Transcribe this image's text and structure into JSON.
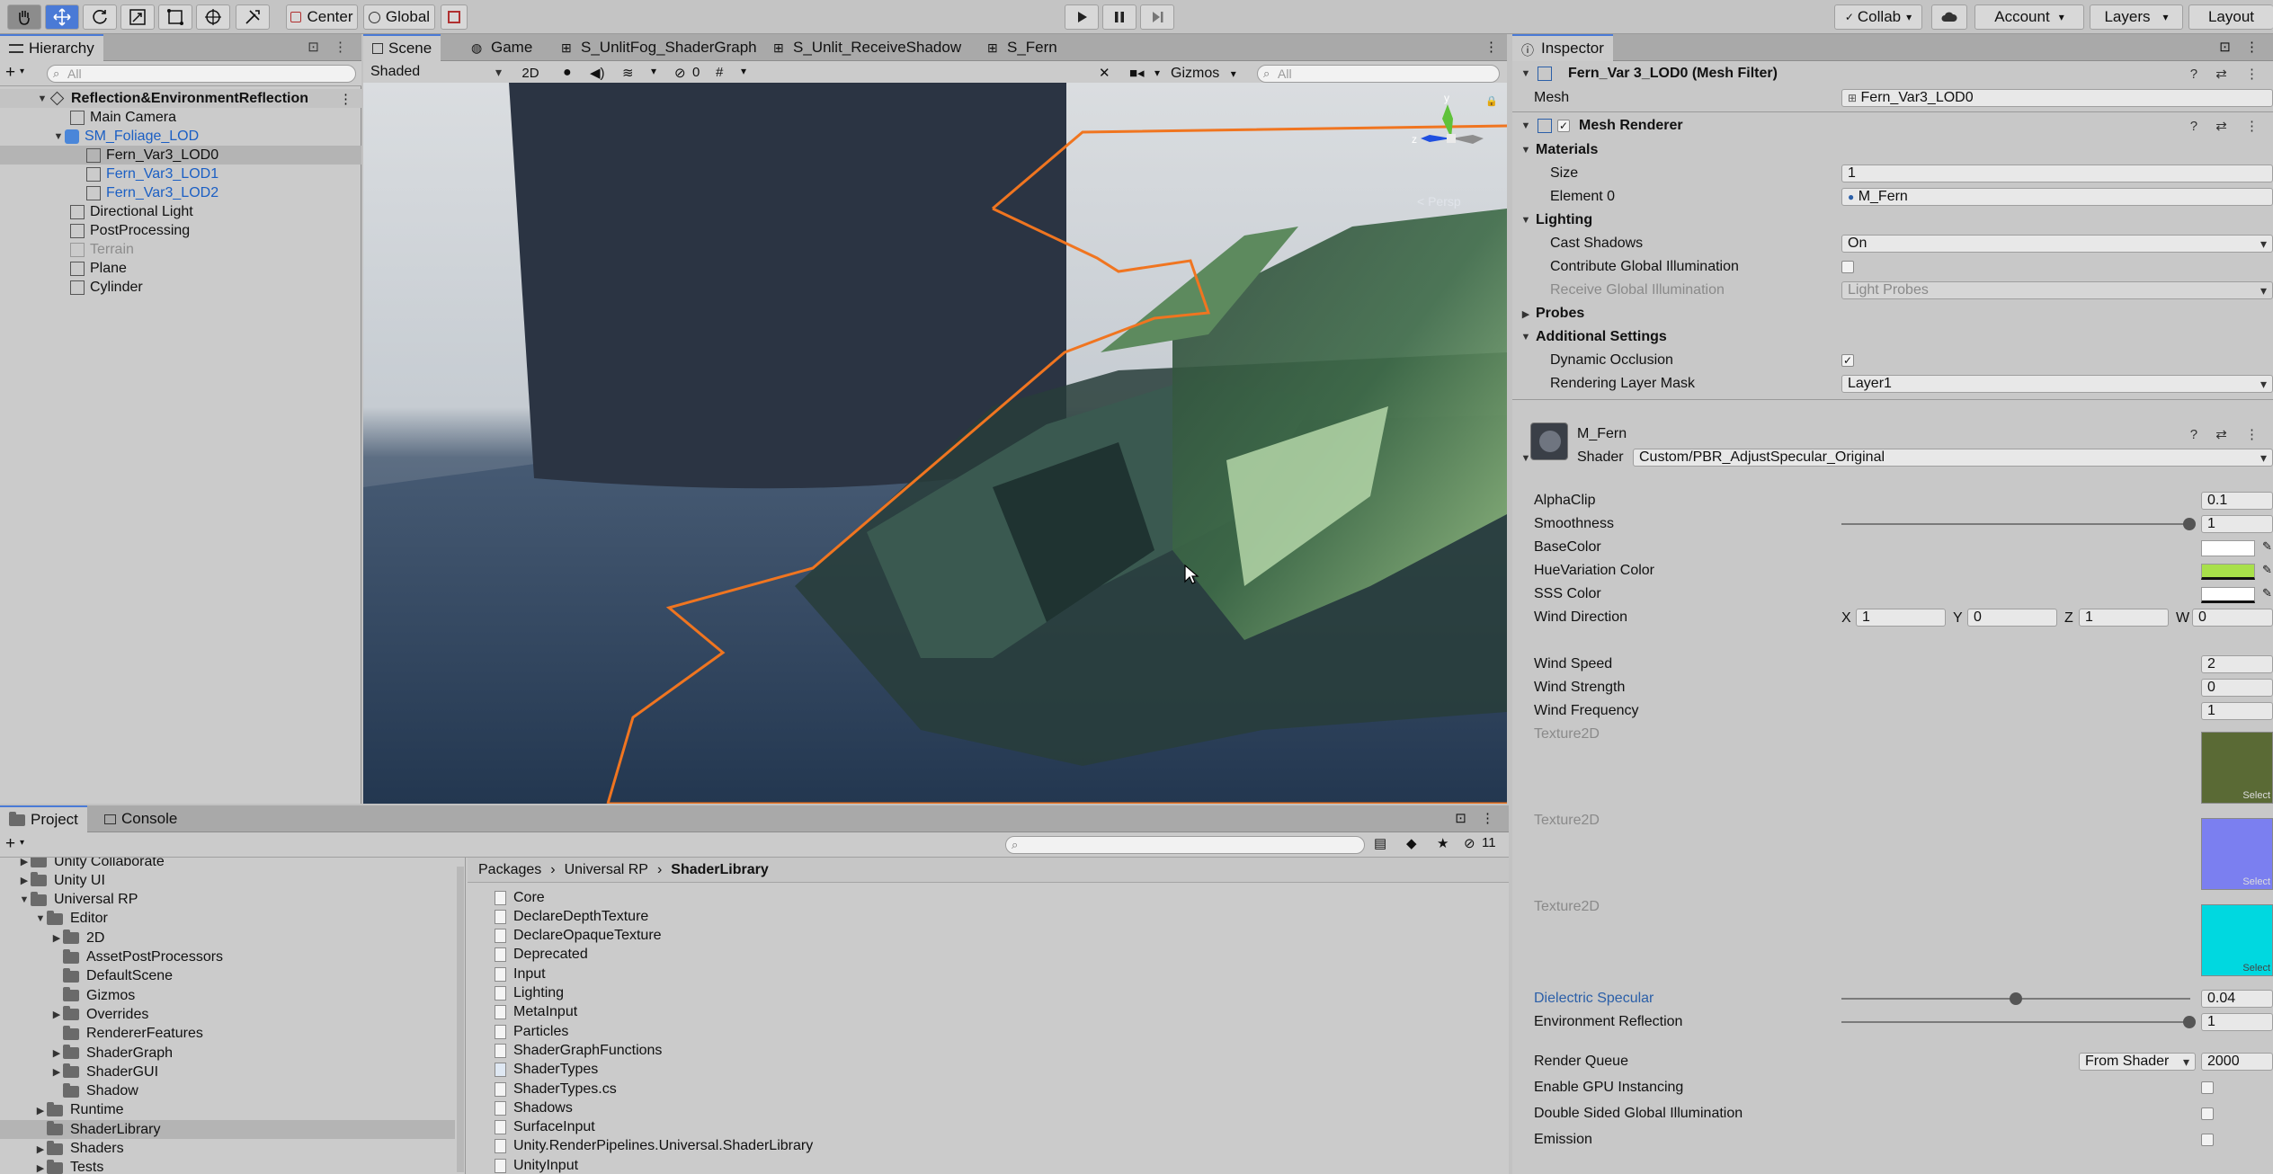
{
  "toolbar": {
    "pivot": "Center",
    "space": "Global",
    "collab": "Collab",
    "account": "Account",
    "layers": "Layers",
    "layout": "Layout"
  },
  "hierarchy": {
    "tab": "Hierarchy",
    "search_placeholder": "All",
    "scene_name": "Reflection&EnvironmentReflection",
    "items": [
      {
        "label": "Main Camera"
      },
      {
        "label": "SM_Foliage_LOD"
      },
      {
        "label": "Fern_Var3_LOD0"
      },
      {
        "label": "Fern_Var3_LOD1"
      },
      {
        "label": "Fern_Var3_LOD2"
      },
      {
        "label": "Directional Light"
      },
      {
        "label": "PostProcessing"
      },
      {
        "label": "Terrain"
      },
      {
        "label": "Plane"
      },
      {
        "label": "Cylinder"
      }
    ]
  },
  "scene": {
    "tabs": [
      "Scene",
      "Game",
      "S_UnlitFog_ShaderGraph",
      "S_Unlit_ReceiveShadow",
      "S_Fern"
    ],
    "shading_mode": "Shaded",
    "mode_2d": "2D",
    "hidden_count": "0",
    "gizmos": "Gizmos",
    "search_placeholder": "All",
    "persp_label": "< Persp",
    "gizmo_axes": {
      "x": "x",
      "y": "y",
      "z": "z"
    }
  },
  "project": {
    "tabs": [
      "Project",
      "Console"
    ],
    "count_badge": "11",
    "breadcrumb": [
      "Packages",
      "Universal RP",
      "ShaderLibrary"
    ],
    "tree": [
      {
        "label": "Unity Collaborate"
      },
      {
        "label": "Unity UI"
      },
      {
        "label": "Universal RP"
      },
      {
        "label": "Editor"
      },
      {
        "label": "2D"
      },
      {
        "label": "AssetPostProcessors"
      },
      {
        "label": "DefaultScene"
      },
      {
        "label": "Gizmos"
      },
      {
        "label": "Overrides"
      },
      {
        "label": "RendererFeatures"
      },
      {
        "label": "ShaderGraph"
      },
      {
        "label": "ShaderGUI"
      },
      {
        "label": "Shadow"
      },
      {
        "label": "Runtime"
      },
      {
        "label": "ShaderLibrary"
      },
      {
        "label": "Shaders"
      },
      {
        "label": "Tests"
      }
    ],
    "files": [
      "Core",
      "DeclareDepthTexture",
      "DeclareOpaqueTexture",
      "Deprecated",
      "Input",
      "Lighting",
      "MetaInput",
      "Particles",
      "ShaderGraphFunctions",
      "ShaderTypes",
      "ShaderTypes.cs",
      "Shadows",
      "SurfaceInput",
      "Unity.RenderPipelines.Universal.ShaderLibrary",
      "UnityInput"
    ]
  },
  "inspector": {
    "tab": "Inspector",
    "mesh_filter": {
      "title": "Fern_Var 3_LOD0 (Mesh Filter)",
      "mesh_label": "Mesh",
      "mesh_value": "Fern_Var3_LOD0"
    },
    "mesh_renderer": {
      "title": "Mesh Renderer",
      "materials": "Materials",
      "size_label": "Size",
      "size_value": "1",
      "element0_label": "Element 0",
      "element0_value": "M_Fern",
      "lighting": "Lighting",
      "cast_shadows_label": "Cast Shadows",
      "cast_shadows_value": "On",
      "contribute_gi": "Contribute Global Illumination",
      "receive_gi_label": "Receive Global Illumination",
      "receive_gi_value": "Light Probes",
      "probes": "Probes",
      "additional": "Additional Settings",
      "dynamic_occlusion": "Dynamic Occlusion",
      "rendering_layer_label": "Rendering Layer Mask",
      "rendering_layer_value": "Layer1"
    },
    "material": {
      "name": "M_Fern",
      "shader_label": "Shader",
      "shader_value": "Custom/PBR_AdjustSpecular_Original",
      "alpha_clip_label": "AlphaClip",
      "alpha_clip_value": "0.1",
      "smoothness_label": "Smoothness",
      "smoothness_value": "1",
      "base_color_label": "BaseColor",
      "hue_variation_label": "HueVariation Color",
      "sss_color_label": "SSS Color",
      "wind_direction_label": "Wind Direction",
      "wind_direction": {
        "x": "1",
        "y": "0",
        "z": "1",
        "w": "0"
      },
      "wind_speed_label": "Wind Speed",
      "wind_speed_value": "2",
      "wind_strength_label": "Wind Strength",
      "wind_strength_value": "0",
      "wind_frequency_label": "Wind Frequency",
      "wind_frequency_value": "1",
      "texture_label": "Texture2D",
      "select_label": "Select",
      "dielectric_label": "Dielectric Specular",
      "dielectric_value": "0.04",
      "dielectric_fraction": 0.5,
      "env_reflection_label": "Environment Reflection",
      "env_reflection_value": "1",
      "render_queue_label": "Render Queue",
      "render_queue_mode": "From Shader",
      "render_queue_value": "2000",
      "gpu_instancing": "Enable GPU Instancing",
      "double_sided_gi": "Double Sided Global Illumination",
      "emission": "Emission"
    },
    "colors": {
      "base": "#ffffff",
      "hue_variation": "#a8e04a",
      "sss": "#ffffff",
      "tex1": "#5a6a35",
      "tex2": "#7b7ff0",
      "tex3": "#00d8e0"
    }
  }
}
